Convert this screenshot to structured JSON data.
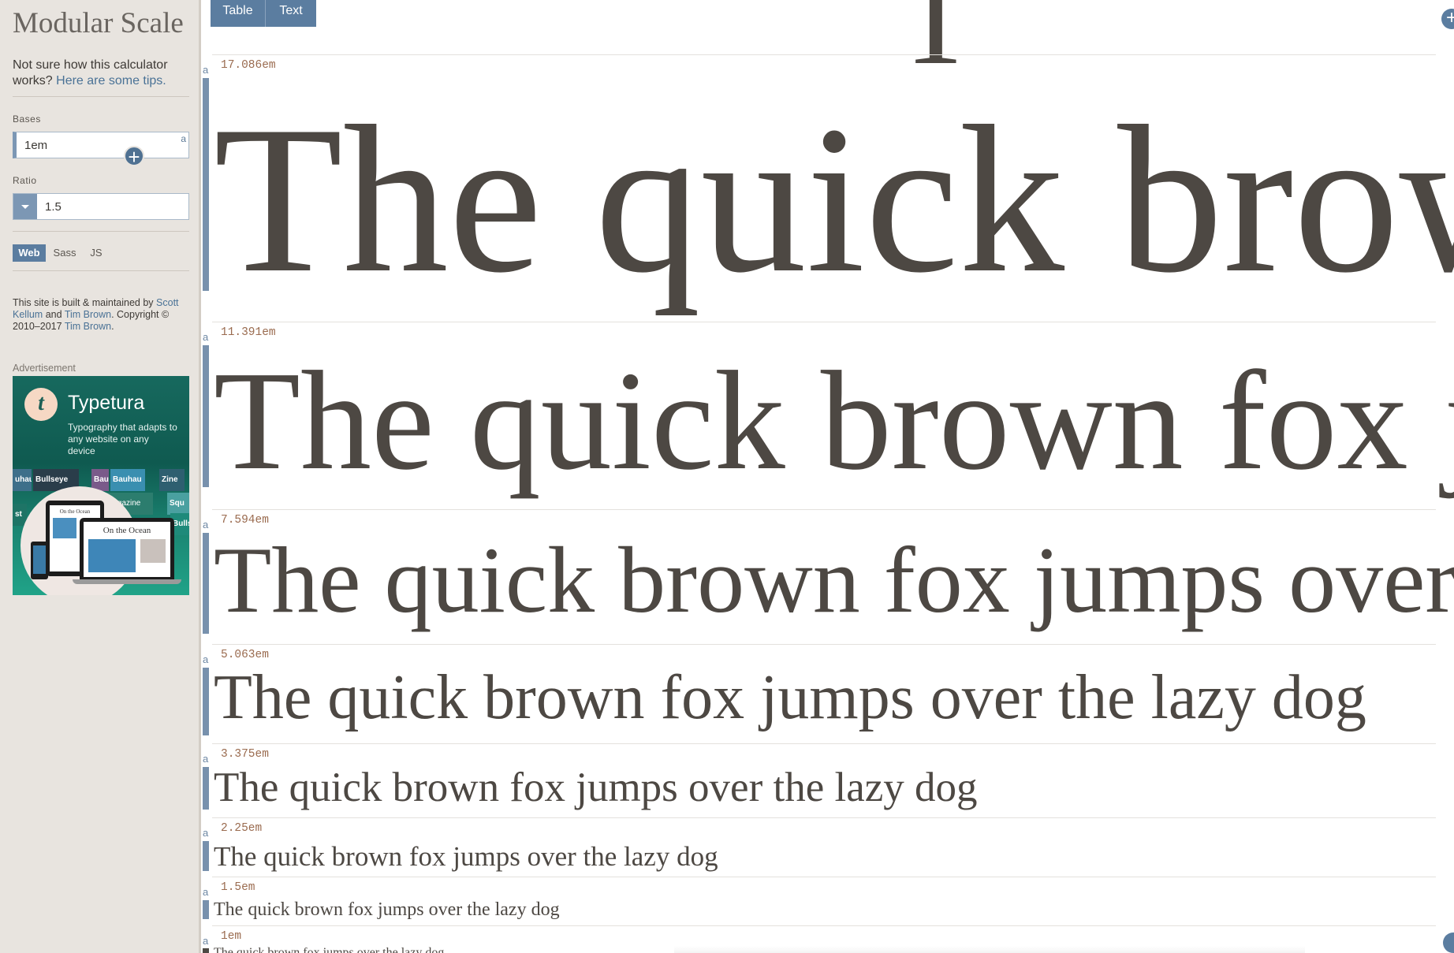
{
  "sidebar": {
    "title": "Modular Scale",
    "intro_text": "Not sure how this calculator works?",
    "intro_link": "Here are some tips.",
    "bases_label": "Bases",
    "base_value": "1em",
    "base_marker": "a",
    "ratio_label": "Ratio",
    "ratio_value": "1.5",
    "format_tabs": [
      {
        "label": "Web",
        "active": true
      },
      {
        "label": "Sass",
        "active": false
      },
      {
        "label": "JS",
        "active": false
      }
    ],
    "credits": {
      "pre": "This site is built & maintained by",
      "author1": "Scott Kellum",
      "and": "and",
      "author2": "Tim Brown",
      "copyright": ". Copyright © 2010–2017",
      "author3": "Tim Brown",
      "end": "."
    },
    "ad_label": "Advertisement",
    "ad": {
      "logo_letter": "t",
      "brand": "Typetura",
      "tagline": "Typography that adapts to any website on any device",
      "strip_words": [
        "uhau",
        "Bullseye",
        "Bau",
        "Bauhau",
        "Zine",
        "Magazine",
        "Squ",
        "Bullse",
        "st"
      ],
      "tablet_caption": "On the Ocean",
      "laptop_caption": "On the Ocean"
    }
  },
  "main": {
    "view_tabs": [
      {
        "label": "Table",
        "active": true
      },
      {
        "label": "Text",
        "active": false
      }
    ],
    "partial_glyph": "T",
    "sample_text": "The quick brown fox jumps over the lazy dog",
    "rows": [
      {
        "size": "17.086em",
        "marker": "a"
      },
      {
        "size": "11.391em",
        "marker": "a"
      },
      {
        "size": "7.594em",
        "marker": "a"
      },
      {
        "size": "5.063em",
        "marker": "a"
      },
      {
        "size": "3.375em",
        "marker": "a"
      },
      {
        "size": "2.25em",
        "marker": "a"
      },
      {
        "size": "1.5em",
        "marker": "a"
      },
      {
        "size": "1em",
        "marker": "a"
      }
    ]
  },
  "colors": {
    "accent": "#5b7da0",
    "sidebar_bg": "#e8e4df",
    "text": "#4d4843",
    "size_label": "#9a6b4f"
  }
}
